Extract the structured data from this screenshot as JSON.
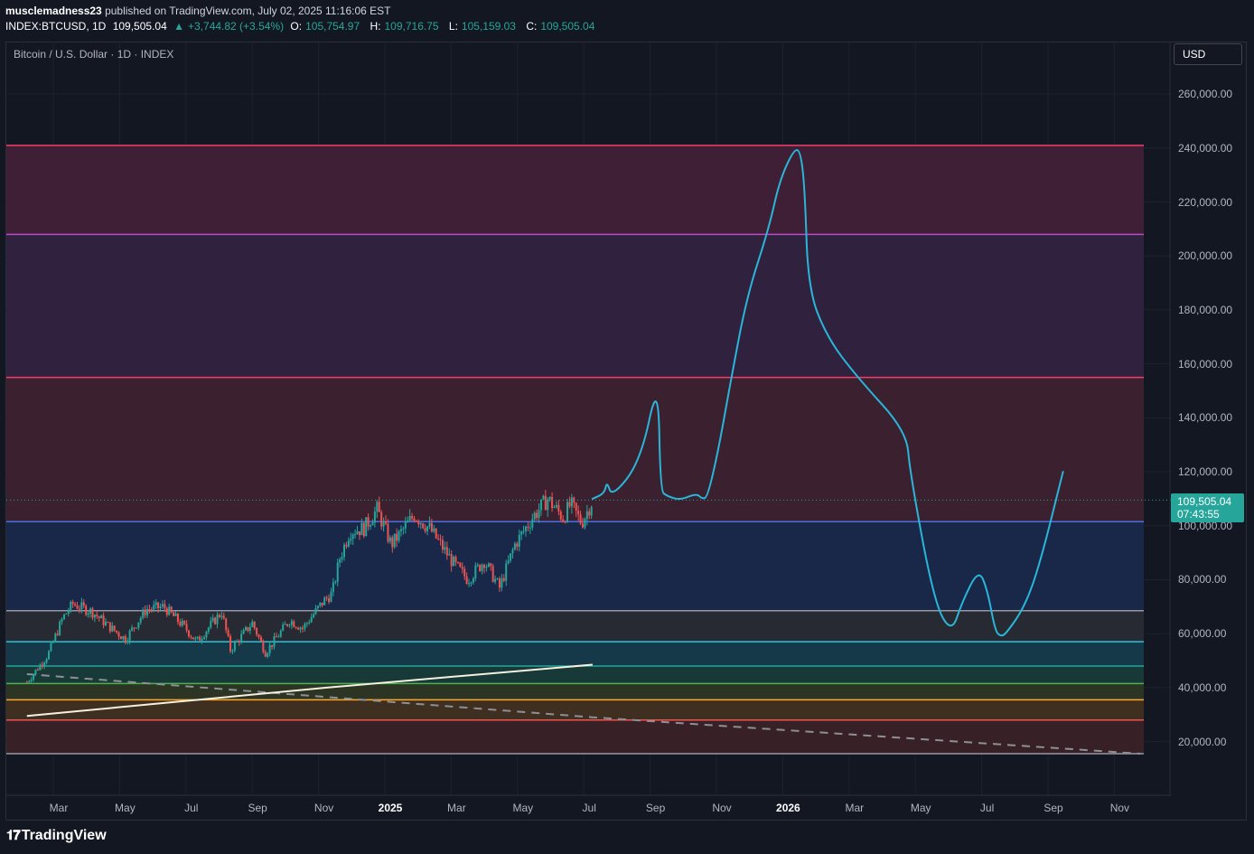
{
  "header": {
    "author": "musclemadness23",
    "published": "published on TradingView.com, July 02, 2025 11:16:06 EST",
    "symbol": "INDEX:BTCUSD, 1D",
    "last": "109,505.04",
    "change": "+3,744.82 (+3.54%)",
    "o_label": "O:",
    "o_value": "105,754.97",
    "h_label": "H:",
    "h_value": "109,716.75",
    "l_label": "L:",
    "l_value": "105,159.03",
    "c_label": "C:",
    "c_value": "109,505.04"
  },
  "legend_title": "Bitcoin / U.S. Dollar · 1D · INDEX",
  "currency_button": "USD",
  "price_tag": {
    "price": "109,505.04",
    "countdown": "07:43:55"
  },
  "footer_brand": "TradingView",
  "colors": {
    "background": "#131722",
    "up": "#26a69a",
    "down": "#ef5350",
    "drawing": "#29b6d8"
  },
  "chart_data": {
    "type": "line",
    "title": "Bitcoin / U.S. Dollar · 1D · INDEX",
    "ylim": [
      0,
      270000
    ],
    "y_ticks": [
      "260,000.00",
      "240,000.00",
      "220,000.00",
      "200,000.00",
      "180,000.00",
      "160,000.00",
      "140,000.00",
      "120,000.00",
      "100,000.00",
      "80,000.00",
      "60,000.00",
      "40,000.00",
      "20,000.00"
    ],
    "x_ticks": [
      {
        "label": "Mar",
        "bold": false
      },
      {
        "label": "May",
        "bold": false
      },
      {
        "label": "Jul",
        "bold": false
      },
      {
        "label": "Sep",
        "bold": false
      },
      {
        "label": "Nov",
        "bold": false
      },
      {
        "label": "2025",
        "bold": true
      },
      {
        "label": "Mar",
        "bold": false
      },
      {
        "label": "May",
        "bold": false
      },
      {
        "label": "Jul",
        "bold": false
      },
      {
        "label": "Sep",
        "bold": false
      },
      {
        "label": "Nov",
        "bold": false
      },
      {
        "label": "2026",
        "bold": true
      },
      {
        "label": "Mar",
        "bold": false
      },
      {
        "label": "May",
        "bold": false
      },
      {
        "label": "Jul",
        "bold": false
      },
      {
        "label": "Sep",
        "bold": false
      },
      {
        "label": "Nov",
        "bold": false
      }
    ],
    "last_price": 109505.04,
    "horizontal_levels": [
      {
        "price": 241000,
        "color": "#f23f6a"
      },
      {
        "price": 208000,
        "color": "#b74cc7"
      },
      {
        "price": 155000,
        "color": "#f23f6a"
      },
      {
        "price": 101500,
        "color": "#4a6ee0"
      },
      {
        "price": 68500,
        "color": "#9598a1"
      },
      {
        "price": 57000,
        "color": "#26c6da"
      },
      {
        "price": 48000,
        "color": "#26a69a"
      },
      {
        "price": 41500,
        "color": "#4caf50"
      },
      {
        "price": 35500,
        "color": "#ffa726"
      },
      {
        "price": 28000,
        "color": "#ef5350"
      },
      {
        "price": 15500,
        "color": "#9598a1"
      }
    ],
    "zones": [
      {
        "from": 208000,
        "to": 241000,
        "color": "#3f1f35"
      },
      {
        "from": 155000,
        "to": 208000,
        "color": "#30213f"
      },
      {
        "from": 101500,
        "to": 155000,
        "color": "#3b2030"
      },
      {
        "from": 68500,
        "to": 101500,
        "color": "#192848"
      },
      {
        "from": 57000,
        "to": 68500,
        "color": "#272a33"
      },
      {
        "from": 48000,
        "to": 57000,
        "color": "#16394a"
      },
      {
        "from": 41500,
        "to": 48000,
        "color": "#173a38"
      },
      {
        "from": 35500,
        "to": 41500,
        "color": "#2c3423"
      },
      {
        "from": 28000,
        "to": 35500,
        "color": "#3f2f20"
      },
      {
        "from": 15500,
        "to": 28000,
        "color": "#372026"
      }
    ],
    "price_series": {
      "name": "BTCUSD",
      "x": [
        "2024-02-01",
        "2024-02-20",
        "2024-03-05",
        "2024-03-14",
        "2024-04-01",
        "2024-04-15",
        "2024-05-01",
        "2024-05-20",
        "2024-06-05",
        "2024-06-25",
        "2024-07-05",
        "2024-07-28",
        "2024-08-05",
        "2024-08-25",
        "2024-09-06",
        "2024-09-28",
        "2024-10-10",
        "2024-10-29",
        "2024-11-06",
        "2024-11-13",
        "2024-11-22",
        "2024-12-05",
        "2024-12-17",
        "2024-12-30",
        "2025-01-07",
        "2025-01-20",
        "2025-02-03",
        "2025-02-25",
        "2025-03-10",
        "2025-03-25",
        "2025-04-08",
        "2025-04-22",
        "2025-05-08",
        "2025-05-22",
        "2025-06-05",
        "2025-06-12",
        "2025-06-22",
        "2025-07-02"
      ],
      "values": [
        42000,
        52000,
        66000,
        71000,
        68000,
        63000,
        58000,
        69000,
        70000,
        62000,
        57000,
        68000,
        54000,
        64000,
        53000,
        65000,
        62000,
        72000,
        75000,
        88000,
        98000,
        99000,
        106000,
        93000,
        97000,
        104000,
        99000,
        86000,
        80000,
        87000,
        77000,
        93000,
        103000,
        110000,
        103000,
        108000,
        101000,
        109505
      ]
    },
    "moving_average_200w": {
      "x": [
        "2024-02-01",
        "2024-11-01",
        "2025-07-02"
      ],
      "values": [
        29500,
        40000,
        48500
      ]
    },
    "dashed_trendline": {
      "x": [
        "2024-02-01",
        "2025-07-02",
        "2026-11-15"
      ],
      "values": [
        45000,
        29000,
        15500
      ]
    },
    "projection": {
      "x": [
        "2025-07-02",
        "2025-07-13",
        "2025-07-15",
        "2025-07-20",
        "2025-08-15",
        "2025-08-31",
        "2025-09-02",
        "2025-09-08",
        "2025-09-20",
        "2025-10-05",
        "2025-10-10",
        "2025-10-15",
        "2025-10-25",
        "2025-11-05",
        "2025-11-20",
        "2025-12-10",
        "2025-12-20",
        "2026-01-02",
        "2026-01-08",
        "2026-01-12",
        "2026-01-15",
        "2026-02-01",
        "2026-03-01",
        "2026-04-15",
        "2026-04-18",
        "2026-05-10",
        "2026-05-26",
        "2026-06-05",
        "2026-06-20",
        "2026-06-28",
        "2026-07-05",
        "2026-07-10",
        "2026-07-15",
        "2026-08-01",
        "2026-08-15",
        "2026-09-05"
      ],
      "values": [
        110000,
        112000,
        116500,
        110500,
        124000,
        155000,
        113000,
        111000,
        109500,
        112000,
        110000,
        110500,
        128000,
        153000,
        185000,
        210000,
        228000,
        239500,
        239000,
        225000,
        188000,
        170000,
        155000,
        135000,
        120000,
        72000,
        60000,
        72000,
        84000,
        76000,
        61000,
        59000,
        60000,
        70000,
        86000,
        120000
      ]
    }
  }
}
